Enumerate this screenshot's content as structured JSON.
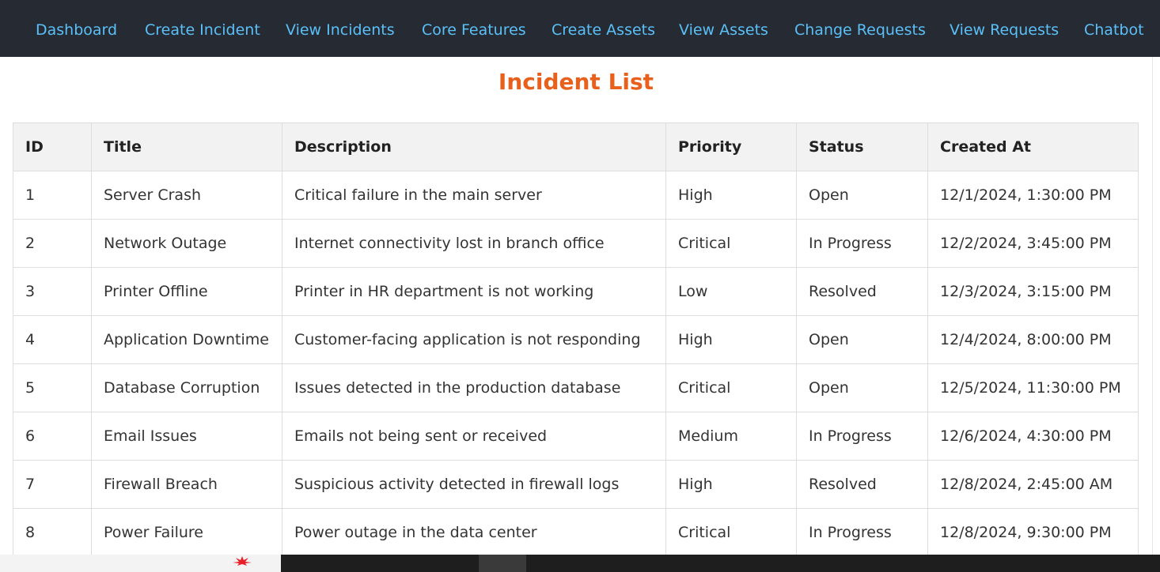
{
  "nav": {
    "items": [
      {
        "label": "Dashboard"
      },
      {
        "label": "Create Incident"
      },
      {
        "label": "View Incidents"
      },
      {
        "label": "Core Features"
      },
      {
        "label": "Create Assets"
      },
      {
        "label": "View Assets"
      },
      {
        "label": "Change Requests"
      },
      {
        "label": "View Requests"
      },
      {
        "label": "Chatbot"
      }
    ]
  },
  "page": {
    "title": "Incident List"
  },
  "table": {
    "columns": [
      "ID",
      "Title",
      "Description",
      "Priority",
      "Status",
      "Created At"
    ],
    "rows": [
      [
        "1",
        "Server Crash",
        "Critical failure in the main server",
        "High",
        "Open",
        "12/1/2024, 1:30:00 PM"
      ],
      [
        "2",
        "Network Outage",
        "Internet connectivity lost in branch office",
        "Critical",
        "In Progress",
        "12/2/2024, 3:45:00 PM"
      ],
      [
        "3",
        "Printer Offline",
        "Printer in HR department is not working",
        "Low",
        "Resolved",
        "12/3/2024, 3:15:00 PM"
      ],
      [
        "4",
        "Application Downtime",
        "Customer-facing application is not responding",
        "High",
        "Open",
        "12/4/2024, 8:00:00 PM"
      ],
      [
        "5",
        "Database Corruption",
        "Issues detected in the production database",
        "Critical",
        "Open",
        "12/5/2024, 11:30:00 PM"
      ],
      [
        "6",
        "Email Issues",
        "Emails not being sent or received",
        "Medium",
        "In Progress",
        "12/6/2024, 4:30:00 PM"
      ],
      [
        "7",
        "Firewall Breach",
        "Suspicious activity detected in firewall logs",
        "High",
        "Resolved",
        "12/8/2024, 2:45:00 AM"
      ],
      [
        "8",
        "Power Failure",
        "Power outage in the data center",
        "Critical",
        "In Progress",
        "12/8/2024, 9:30:00 PM"
      ]
    ]
  },
  "colors": {
    "navbar_bg": "#252a33",
    "nav_link": "#5bc0f8",
    "title": "#e8601c",
    "header_bg": "#f2f2f2",
    "border": "#dddddd"
  }
}
